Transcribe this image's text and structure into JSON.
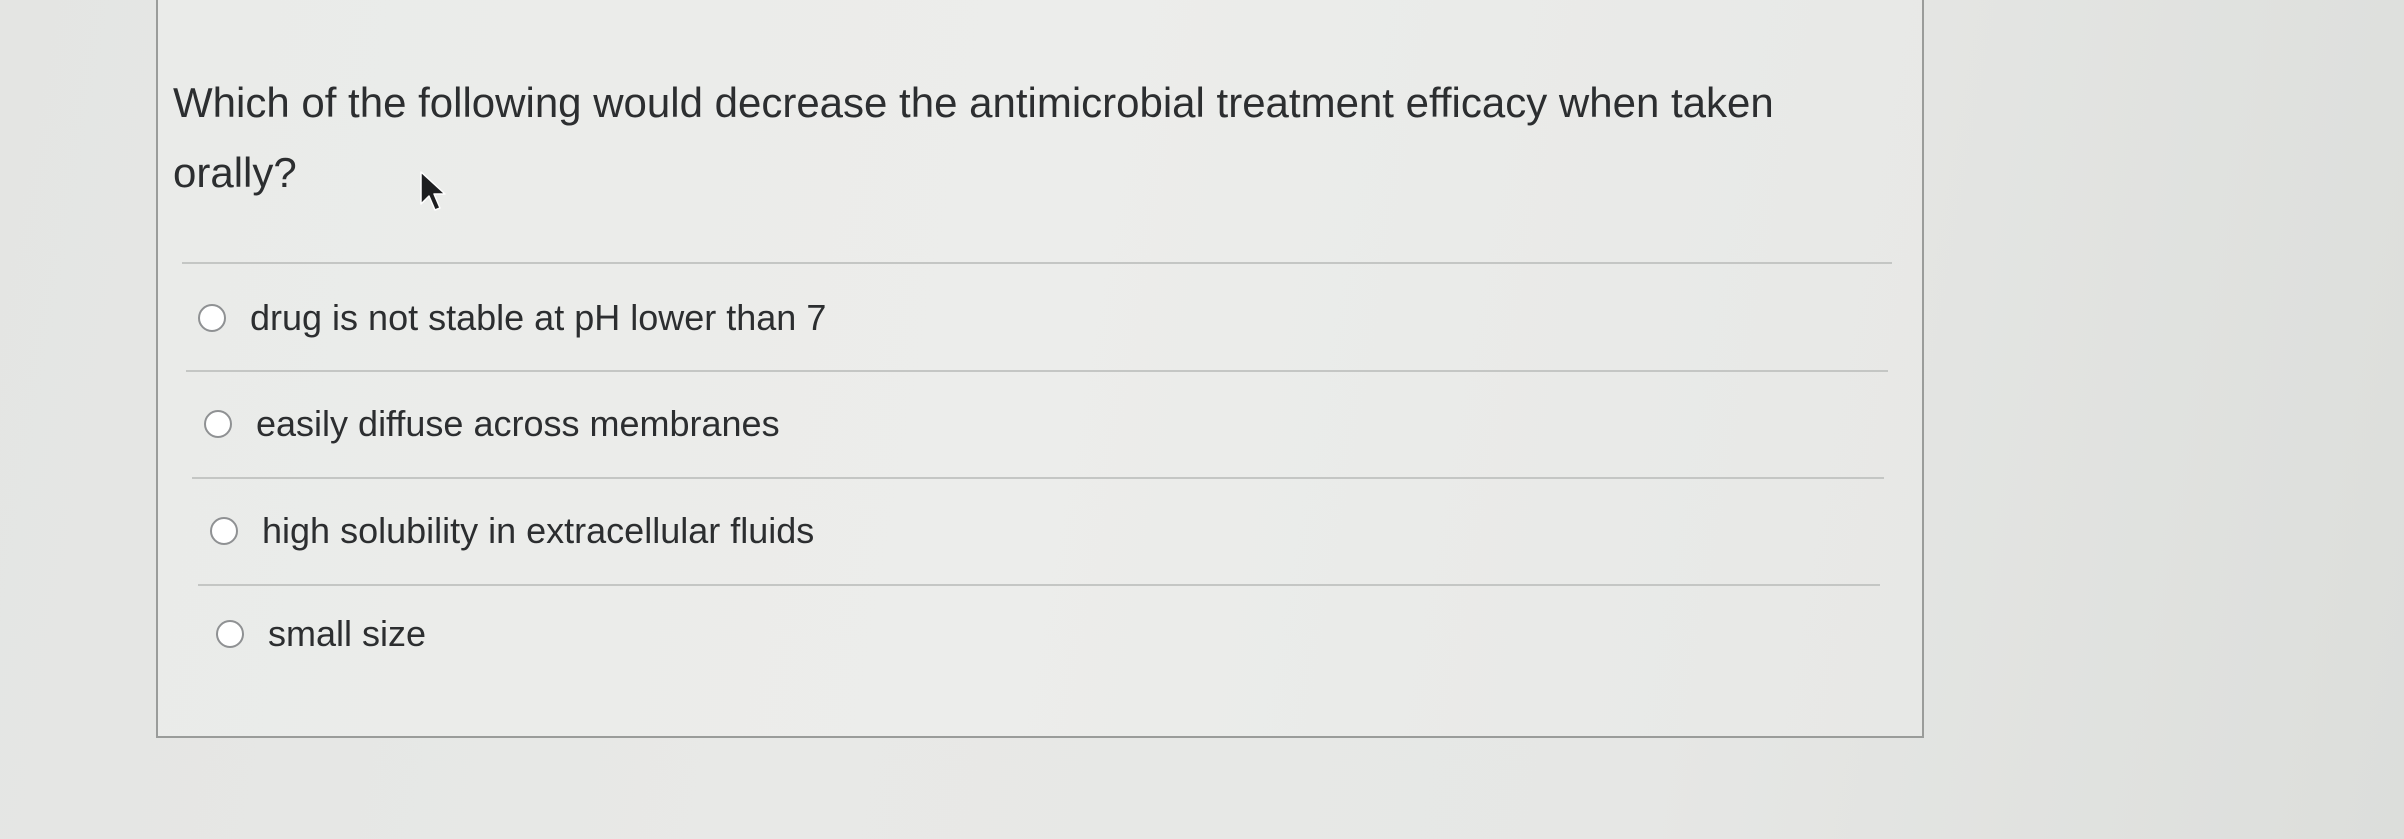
{
  "question": {
    "text": "Which of the following would decrease the antimicrobial treatment efficacy when taken orally?"
  },
  "options": [
    {
      "label": "drug is not stable at pH lower than 7",
      "selected": false
    },
    {
      "label": "easily diffuse across membranes",
      "selected": false
    },
    {
      "label": "high solubility in extracellular fluids",
      "selected": false
    },
    {
      "label": "small size",
      "selected": false
    }
  ],
  "icons": {
    "radio": "radio-button-unselected",
    "pointer": "mouse-pointer-arrow"
  },
  "colors": {
    "text": "#2c2e30",
    "card_border": "#9a9c9a",
    "divider": "#c4c6c4",
    "radio_border": "#8f9193"
  }
}
